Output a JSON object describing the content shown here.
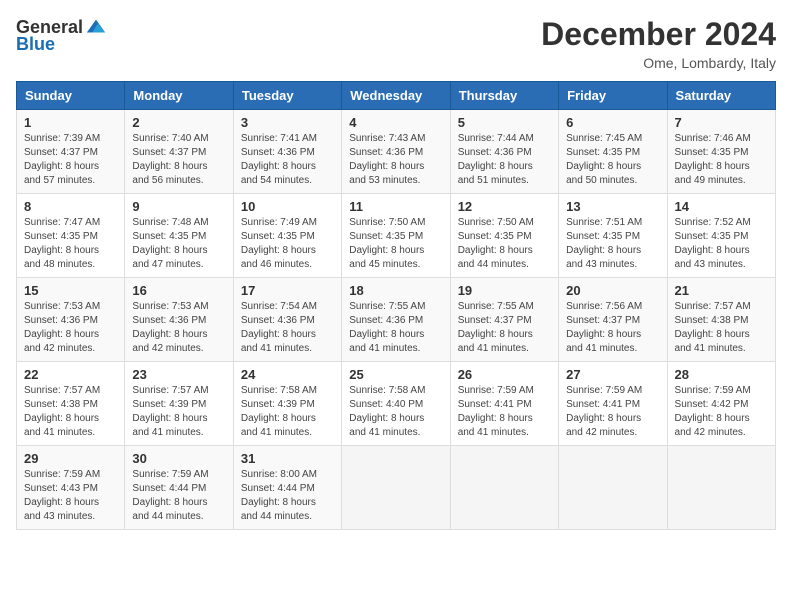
{
  "logo": {
    "general": "General",
    "blue": "Blue"
  },
  "title": "December 2024",
  "location": "Ome, Lombardy, Italy",
  "days_of_week": [
    "Sunday",
    "Monday",
    "Tuesday",
    "Wednesday",
    "Thursday",
    "Friday",
    "Saturday"
  ],
  "weeks": [
    [
      {
        "day": "1",
        "sunrise": "7:39 AM",
        "sunset": "4:37 PM",
        "daylight": "8 hours and 57 minutes."
      },
      {
        "day": "2",
        "sunrise": "7:40 AM",
        "sunset": "4:37 PM",
        "daylight": "8 hours and 56 minutes."
      },
      {
        "day": "3",
        "sunrise": "7:41 AM",
        "sunset": "4:36 PM",
        "daylight": "8 hours and 54 minutes."
      },
      {
        "day": "4",
        "sunrise": "7:43 AM",
        "sunset": "4:36 PM",
        "daylight": "8 hours and 53 minutes."
      },
      {
        "day": "5",
        "sunrise": "7:44 AM",
        "sunset": "4:36 PM",
        "daylight": "8 hours and 51 minutes."
      },
      {
        "day": "6",
        "sunrise": "7:45 AM",
        "sunset": "4:35 PM",
        "daylight": "8 hours and 50 minutes."
      },
      {
        "day": "7",
        "sunrise": "7:46 AM",
        "sunset": "4:35 PM",
        "daylight": "8 hours and 49 minutes."
      }
    ],
    [
      {
        "day": "8",
        "sunrise": "7:47 AM",
        "sunset": "4:35 PM",
        "daylight": "8 hours and 48 minutes."
      },
      {
        "day": "9",
        "sunrise": "7:48 AM",
        "sunset": "4:35 PM",
        "daylight": "8 hours and 47 minutes."
      },
      {
        "day": "10",
        "sunrise": "7:49 AM",
        "sunset": "4:35 PM",
        "daylight": "8 hours and 46 minutes."
      },
      {
        "day": "11",
        "sunrise": "7:50 AM",
        "sunset": "4:35 PM",
        "daylight": "8 hours and 45 minutes."
      },
      {
        "day": "12",
        "sunrise": "7:50 AM",
        "sunset": "4:35 PM",
        "daylight": "8 hours and 44 minutes."
      },
      {
        "day": "13",
        "sunrise": "7:51 AM",
        "sunset": "4:35 PM",
        "daylight": "8 hours and 43 minutes."
      },
      {
        "day": "14",
        "sunrise": "7:52 AM",
        "sunset": "4:35 PM",
        "daylight": "8 hours and 43 minutes."
      }
    ],
    [
      {
        "day": "15",
        "sunrise": "7:53 AM",
        "sunset": "4:36 PM",
        "daylight": "8 hours and 42 minutes."
      },
      {
        "day": "16",
        "sunrise": "7:53 AM",
        "sunset": "4:36 PM",
        "daylight": "8 hours and 42 minutes."
      },
      {
        "day": "17",
        "sunrise": "7:54 AM",
        "sunset": "4:36 PM",
        "daylight": "8 hours and 41 minutes."
      },
      {
        "day": "18",
        "sunrise": "7:55 AM",
        "sunset": "4:36 PM",
        "daylight": "8 hours and 41 minutes."
      },
      {
        "day": "19",
        "sunrise": "7:55 AM",
        "sunset": "4:37 PM",
        "daylight": "8 hours and 41 minutes."
      },
      {
        "day": "20",
        "sunrise": "7:56 AM",
        "sunset": "4:37 PM",
        "daylight": "8 hours and 41 minutes."
      },
      {
        "day": "21",
        "sunrise": "7:57 AM",
        "sunset": "4:38 PM",
        "daylight": "8 hours and 41 minutes."
      }
    ],
    [
      {
        "day": "22",
        "sunrise": "7:57 AM",
        "sunset": "4:38 PM",
        "daylight": "8 hours and 41 minutes."
      },
      {
        "day": "23",
        "sunrise": "7:57 AM",
        "sunset": "4:39 PM",
        "daylight": "8 hours and 41 minutes."
      },
      {
        "day": "24",
        "sunrise": "7:58 AM",
        "sunset": "4:39 PM",
        "daylight": "8 hours and 41 minutes."
      },
      {
        "day": "25",
        "sunrise": "7:58 AM",
        "sunset": "4:40 PM",
        "daylight": "8 hours and 41 minutes."
      },
      {
        "day": "26",
        "sunrise": "7:59 AM",
        "sunset": "4:41 PM",
        "daylight": "8 hours and 41 minutes."
      },
      {
        "day": "27",
        "sunrise": "7:59 AM",
        "sunset": "4:41 PM",
        "daylight": "8 hours and 42 minutes."
      },
      {
        "day": "28",
        "sunrise": "7:59 AM",
        "sunset": "4:42 PM",
        "daylight": "8 hours and 42 minutes."
      }
    ],
    [
      {
        "day": "29",
        "sunrise": "7:59 AM",
        "sunset": "4:43 PM",
        "daylight": "8 hours and 43 minutes."
      },
      {
        "day": "30",
        "sunrise": "7:59 AM",
        "sunset": "4:44 PM",
        "daylight": "8 hours and 44 minutes."
      },
      {
        "day": "31",
        "sunrise": "8:00 AM",
        "sunset": "4:44 PM",
        "daylight": "8 hours and 44 minutes."
      },
      null,
      null,
      null,
      null
    ]
  ],
  "labels": {
    "sunrise": "Sunrise:",
    "sunset": "Sunset:",
    "daylight": "Daylight:"
  }
}
